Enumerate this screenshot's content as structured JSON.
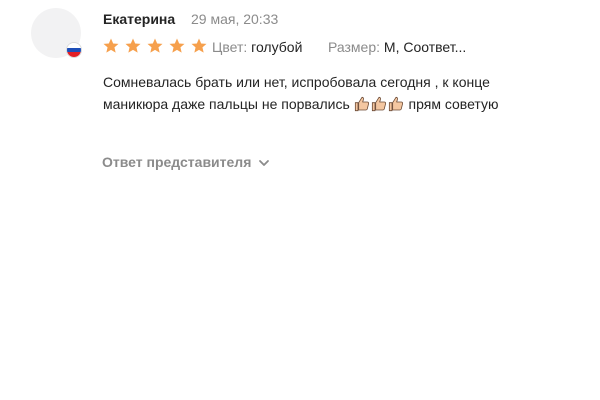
{
  "review": {
    "author": "Екатерина",
    "date": "29 мая, 20:33",
    "rating": 5,
    "rating_max": 5,
    "attributes": [
      {
        "label": "Цвет:",
        "value": "голубой"
      },
      {
        "label": "Размер:",
        "value": "М, Соответ..."
      }
    ],
    "text_part1": "Сомневалась брать или нет, испробовала сегодня , к конце маникюра даже пальцы не порвались ",
    "text_part2": " прям советую",
    "emoji": "thumbs-up-icon",
    "emoji_count": 3,
    "reply_label": "Ответ представителя",
    "colors": {
      "star": "#f6a04d",
      "muted": "#8b8b8b",
      "text": "#242424"
    }
  }
}
